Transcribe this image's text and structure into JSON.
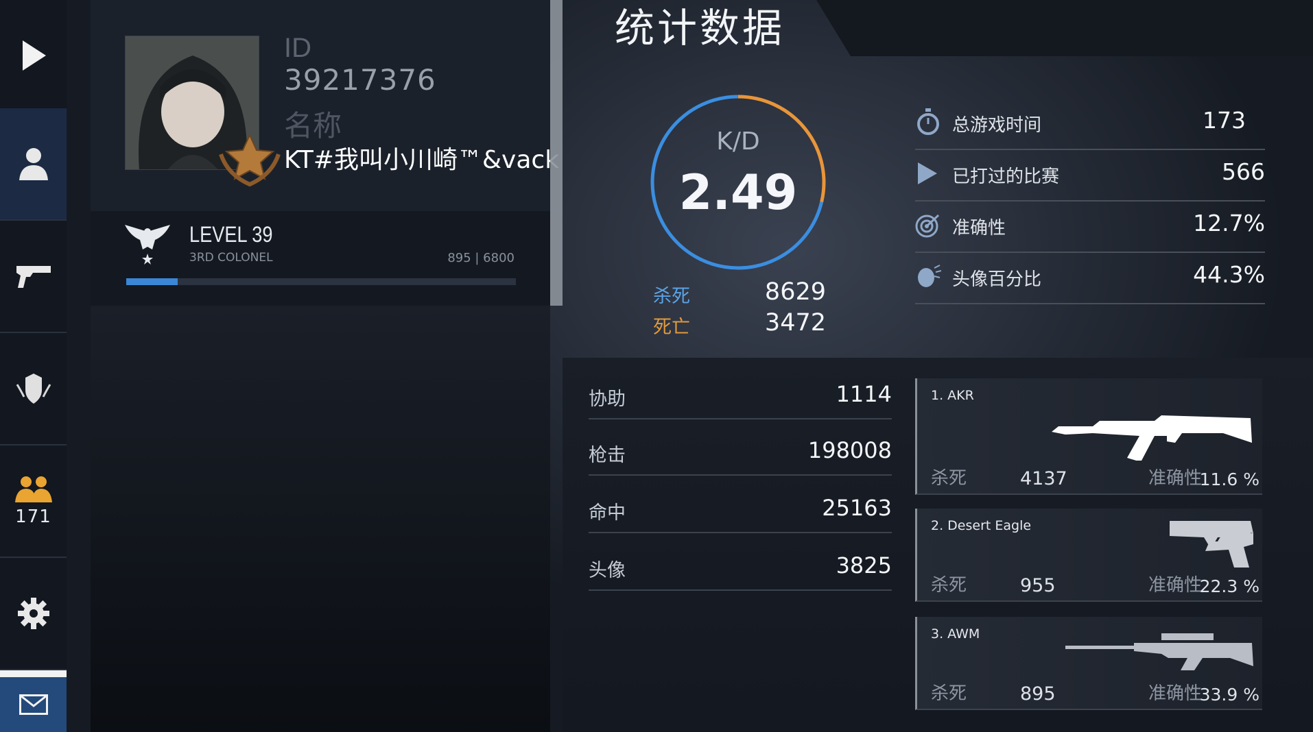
{
  "sidebar": {
    "friends_count": "171"
  },
  "profile": {
    "id_label": "ID",
    "id_value": "39217376",
    "name_label": "名称",
    "name_value": "KT#我叫小川崎™&vack",
    "level": "LEVEL 39",
    "rank": "3RD COLONEL",
    "xp": "895 | 6800",
    "xp_progress_percent": 13.2
  },
  "stats": {
    "title": "统计数据",
    "kd_label": "K/D",
    "kd_value": "2.49",
    "kills_label": "杀死",
    "kills_value": "8629",
    "deaths_label": "死亡",
    "deaths_value": "3472",
    "kd_ring_colors": {
      "kills": "#3b8ee0",
      "deaths": "#e8953a"
    },
    "summary": [
      {
        "icon": "stopwatch-icon",
        "label": "总游戏时间",
        "value": "173"
      },
      {
        "icon": "play-icon",
        "label": "已打过的比赛",
        "value": "566"
      },
      {
        "icon": "target-icon",
        "label": "准确性",
        "value": "12.7%"
      },
      {
        "icon": "head-icon",
        "label": "头像百分比",
        "value": "44.3%"
      }
    ],
    "details": [
      {
        "label": "协助",
        "value": "1114"
      },
      {
        "label": "枪击",
        "value": "198008"
      },
      {
        "label": "命中",
        "value": "25163"
      },
      {
        "label": "头像",
        "value": "3825"
      }
    ]
  },
  "weapons": [
    {
      "name": "1. AKR",
      "kills_label": "杀死",
      "kills": "4137",
      "acc_label": "准确性",
      "acc": "11.6 %",
      "icon": "rifle-icon"
    },
    {
      "name": "2. Desert Eagle",
      "kills_label": "杀死",
      "kills": "955",
      "acc_label": "准确性",
      "acc": "22.3 %",
      "icon": "pistol-icon"
    },
    {
      "name": "3. AWM",
      "kills_label": "杀死",
      "kills": "895",
      "acc_label": "准确性",
      "acc": "33.9 %",
      "icon": "sniper-rifle-icon"
    }
  ]
}
